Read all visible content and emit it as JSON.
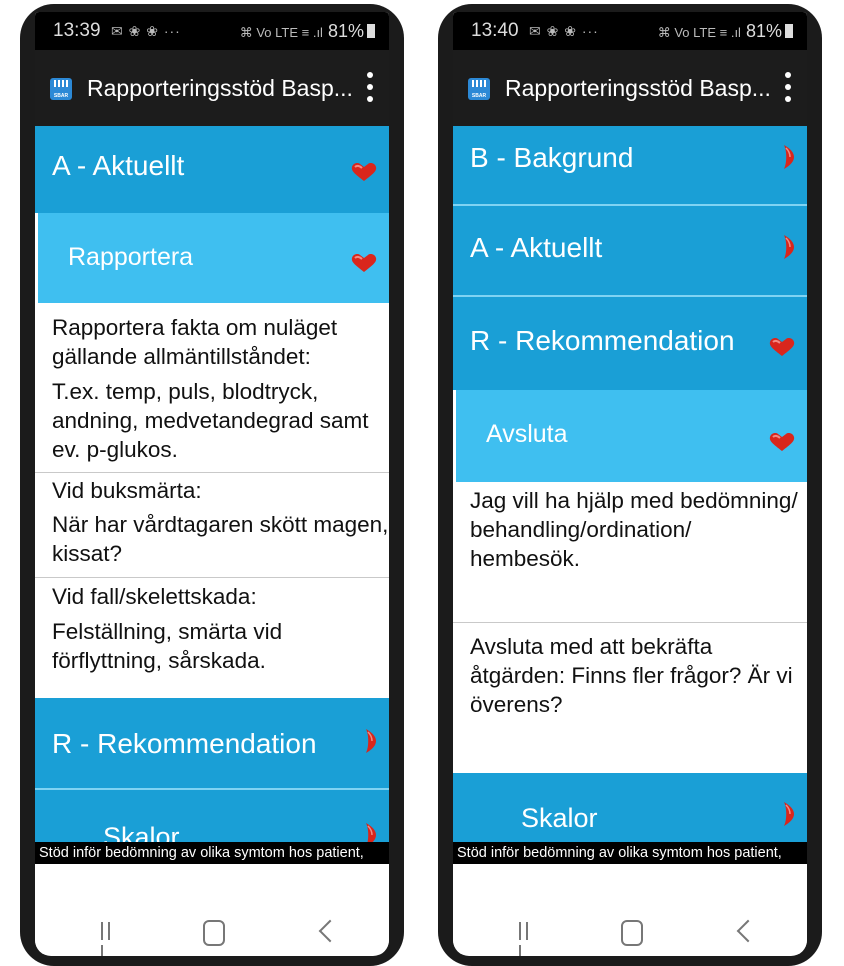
{
  "phones": [
    {
      "status": {
        "time": "13:39",
        "icons": "✉ ❀ ❀  ···",
        "battery": "81%",
        "net_icons": "⌘ Vo LTE ≡ .ıl"
      },
      "appbar": {
        "icon_label": "SBAR",
        "title": "Rapporteringsstöd Basp..."
      },
      "rows": [
        {
          "label": "A - Aktuellt",
          "icon": "heart-expanded-icon"
        },
        {
          "label": "Rapportera",
          "icon": "heart-expanded-icon"
        },
        {
          "label": "R - Rekommendation",
          "icon": "chevron-right-icon"
        },
        {
          "label": "Skalor",
          "icon": "chevron-right-icon"
        }
      ],
      "content": [
        {
          "lines": [
            "Rapportera fakta om nuläget",
            "gällande allmäntillståndet:"
          ]
        },
        {
          "lines": [
            "T.ex. temp, puls, blodtryck,",
            "andning, medvetandegrad samt",
            "ev. p-glukos."
          ]
        },
        {
          "lines": [
            "Vid buksmärta:"
          ]
        },
        {
          "lines": [
            "När har vårdtagaren skött magen,",
            "kissat?"
          ]
        },
        {
          "lines": [
            "Vid fall/skelettskada:"
          ]
        },
        {
          "lines": [
            "Felställning, smärta vid",
            "förflyttning, sårskada."
          ]
        }
      ],
      "footer": "Stöd inför bedömning av olika symtom hos patient,"
    },
    {
      "status": {
        "time": "13:40",
        "icons": "✉ ❀ ❀  ···",
        "battery": "81%",
        "net_icons": "⌘ Vo LTE ≡ .ıl"
      },
      "appbar": {
        "icon_label": "SBAR",
        "title": "Rapporteringsstöd Basp..."
      },
      "rows": [
        {
          "label": "B - Bakgrund",
          "icon": "chevron-right-icon"
        },
        {
          "label": "A - Aktuellt",
          "icon": "chevron-right-icon"
        },
        {
          "label": "R - Rekommendation",
          "icon": "heart-expanded-icon"
        },
        {
          "label": "Avsluta",
          "icon": "heart-expanded-icon"
        },
        {
          "label": "Skalor",
          "icon": "chevron-right-icon"
        }
      ],
      "content": [
        {
          "lines": [
            "Jag vill ha hjälp med bedömning/",
            "behandling/ordination/",
            "hembesök."
          ]
        },
        {
          "lines": [
            "Avsluta med att bekräfta",
            "åtgärden: Finns fler frågor? Är vi",
            "överens?"
          ]
        }
      ],
      "footer": "Stöd inför bedömning av olika symtom hos patient,"
    }
  ],
  "colors": {
    "section_dark": "#1a9fd6",
    "section_light": "#3fbff0",
    "icon_red": "#d9261c"
  }
}
